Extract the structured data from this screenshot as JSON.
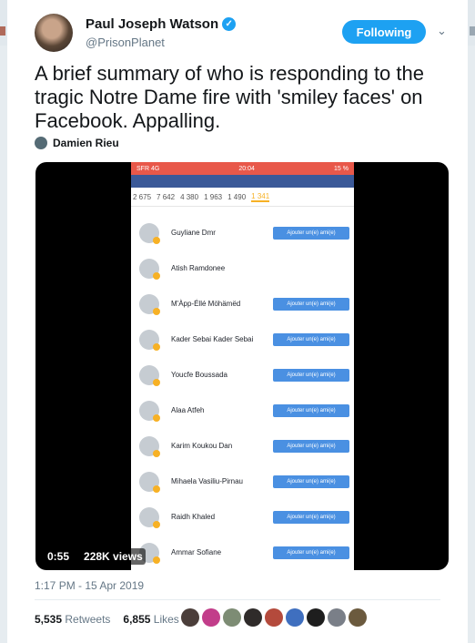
{
  "user": {
    "name": "Paul Joseph Watson",
    "handle": "@PrisonPlanet",
    "verified_mark": "✓",
    "follow_label": "Following"
  },
  "tweet": {
    "text": "A brief summary of who is responding to the tragic Notre Dame fire with 'smiley faces' on Facebook. Appalling.",
    "mention_name": "Damien Rieu",
    "timestamp": "1:17 PM - 15 Apr 2019",
    "retweets_count": "5,535",
    "retweets_label": "Retweets",
    "likes_count": "6,855",
    "likes_label": "Likes"
  },
  "video": {
    "duration": "0:55",
    "views": "228K views",
    "phone": {
      "carrier": "SFR 4G",
      "time": "20:04",
      "battery": "15 %",
      "reactions": [
        "2 675",
        "7 642",
        "4 380",
        "1 963",
        "1 490",
        "1 341"
      ],
      "add_friend_label": "Ajouter un(e) ami(e)",
      "friends": [
        "Guyliane Dmr",
        "Atish Ramdonee",
        "M'Àpp-Éllé Möhämëd",
        "Kader Sebai Kader Sebai",
        "Youcfe Boussada",
        "Alaa Atfeh",
        "Karim Koukou Dan",
        "Mihaela Vasiliu-Pirnau",
        "Raidh Khaled",
        "Ammar Sofiane"
      ]
    }
  },
  "colors": {
    "accent": "#1da1f2",
    "text": "#14171a",
    "muted": "#657786"
  }
}
